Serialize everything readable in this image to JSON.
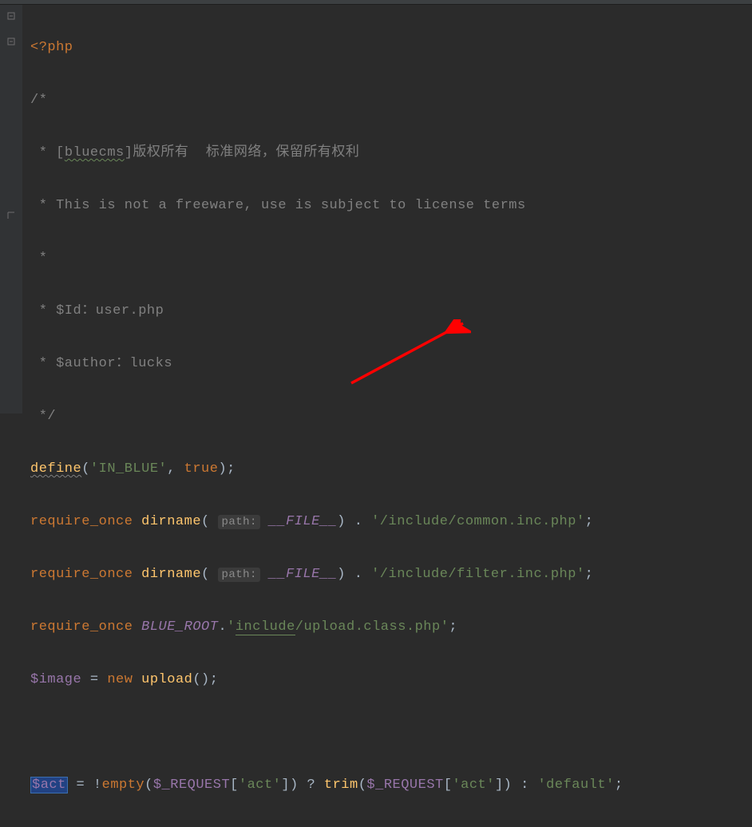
{
  "code": {
    "open_tag": "<?php",
    "comment_open": "/*",
    "comment_star": " *",
    "comment_bluecms_pre": " * [",
    "comment_bluecms_link": "bluecms",
    "comment_bluecms_post": "]版权所有  标准网络，保留所有权利",
    "comment_freeware": " * This is not a freeware, use is subject to license terms",
    "comment_id": " * $Id：user.php",
    "comment_author": " * $author：lucks",
    "comment_close": " */",
    "define_fn": "define",
    "define_arg1": "'IN_BLUE'",
    "define_comma": ", ",
    "define_true": "true",
    "define_close": ");",
    "require": "require_once",
    "dirname": "dirname",
    "path_hint": "path:",
    "file_const": "__FILE__",
    "concat_dot": " . ",
    "req1_str": "'/include/common.inc.php'",
    "req2_str": "'/include/filter.inc.php'",
    "semi": ";",
    "blue_root": "BLUE_ROOT",
    "req3_pre": "'",
    "req3_link": "include",
    "req3_post": "/upload.class.php'",
    "var_image": "$image",
    "eq": " = ",
    "new_kw": "new",
    "upload_fn": "upload",
    "paren_close": "();",
    "var_act": "$act",
    "bang": "!",
    "empty_fn": "empty",
    "request": "$_REQUEST",
    "act_key": "'act'",
    "tern_q": " ? ",
    "trim_fn": "trim",
    "tern_c": " : ",
    "default_str": "'default'"
  }
}
